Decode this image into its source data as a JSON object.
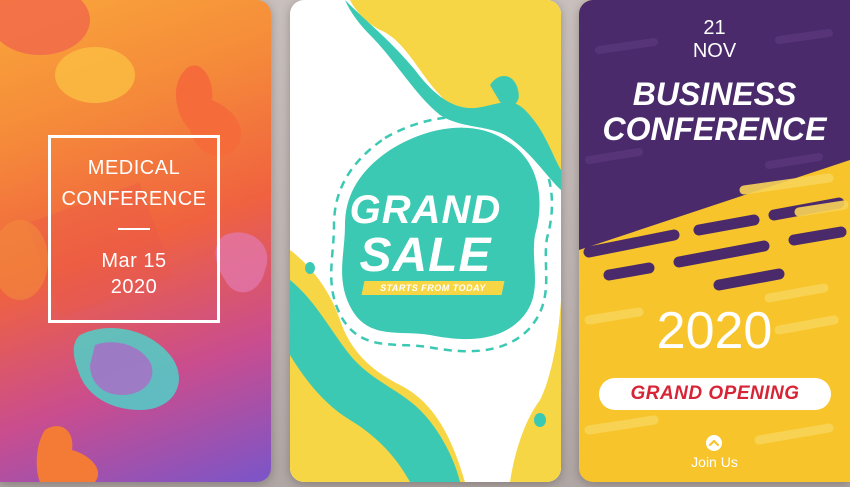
{
  "cards": {
    "medical": {
      "line1": "MEDICAL",
      "line2": "CONFERENCE",
      "date": "Mar 15",
      "year": "2020"
    },
    "sale": {
      "line1": "GRAND",
      "line2": "SALE",
      "tagline": "STARTS FROM TODAY"
    },
    "business": {
      "day": "21",
      "month": "NOV",
      "line1": "BUSINESS",
      "line2": "CONFERENCE",
      "year": "2020",
      "pill": "GRAND OPENING",
      "join": "Join Us"
    }
  },
  "colors": {
    "teal": "#3cc9b3",
    "yellow": "#f7c52b",
    "purple": "#4a2a6b",
    "red": "#d72537",
    "orange": "#f58a3a"
  },
  "icons": {
    "join": "chevron-up-circle-icon"
  }
}
